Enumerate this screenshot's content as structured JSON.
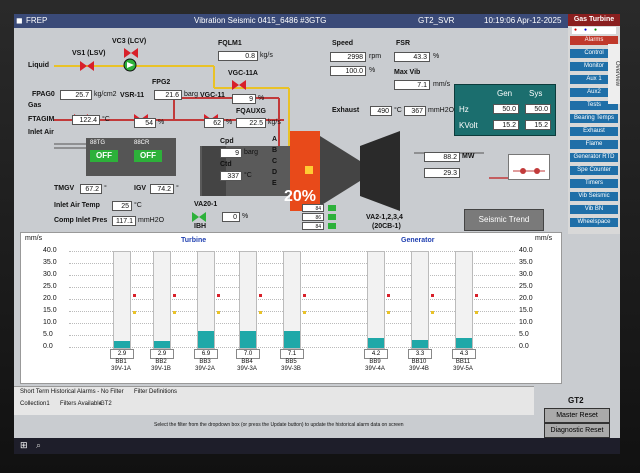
{
  "titlebar": {
    "app": "FREP",
    "title": "Vibration Seismic 0415_6486 #3GTG",
    "station": "GT2_SVR",
    "datetime": "10:19:06 Apr-12-2025"
  },
  "sidepanel": {
    "title": "Gas Turbine",
    "items": [
      "Alarms",
      "Control",
      "Monitor",
      "Aux 1",
      "Aux2",
      "Tests",
      "Bearing Temps",
      "Exhaust",
      "Flame",
      "Generator RTD",
      "Spe Counter",
      "Timers",
      "Vib Seismic",
      "Vib BN",
      "Wheelspace"
    ],
    "overview_tab": "Overview"
  },
  "process": {
    "liquid_label": "Liquid",
    "gas_label": "Gas",
    "inlet_air_label": "Inlet Air",
    "vs1": "VS1 (LSV)",
    "vc3": "VC3 (LCV)",
    "fqlm1_label": "FQLM1",
    "fqlm1_value": "0.8",
    "fqlm1_unit": "kg/s",
    "speed_label": "Speed",
    "speed_value": "2998",
    "speed_unit": "rpm",
    "speed_pct": "100.0",
    "fsr_label": "FSR",
    "fsr_value": "43.3",
    "fsr_unit": "%",
    "maxvib_label": "Max Vib",
    "maxvib_value": "7.1",
    "maxvib_unit": "mm/s",
    "fpg2_label": "FPG2",
    "fpg2_value": "21.6",
    "fpg2_unit": "barg",
    "vgc11a_label": "VGC-11A",
    "vgc11a_value": "9",
    "fpago_label": "FPAG0",
    "fpago_value": "25.7",
    "fpago_unit": "kg/cm2",
    "vsr11_label": "VSR-11",
    "vgc11_label": "VGC-11",
    "ftagim_label": "FTAGIM",
    "ftagim_value": "122.4",
    "ftagim_unit": "°C",
    "vsr_pct": "54",
    "vgc_pct": "62",
    "fqauxg_label": "FQAUXG",
    "fqauxg_value": "22.5",
    "fqauxg_unit": "kg/s",
    "exhaust_label": "Exhaust",
    "exhaust_temp": "490",
    "exhaust_temp_unit": "°C",
    "exhaust_press": "367",
    "exhaust_press_unit": "mmH2O",
    "gen_label": "Gen",
    "sys_label": "Sys",
    "hz_label": "Hz",
    "hz_gen": "50.0",
    "hz_sys": "50.0",
    "kvolt_label": "KVolt",
    "kv_gen": "15.2",
    "kv_sys": "15.2",
    "bt_88": "88TG",
    "bt_88_state": "OFF",
    "bt_qcr": "88CR",
    "bt_qcr_state": "OFF",
    "cpd_label": "Cpd",
    "cpd_value": "9",
    "cpd_unit": "barg",
    "ctd_label": "Ctd",
    "ctd_value": "337",
    "ctd_unit": "°C",
    "chambers": [
      "A",
      "B",
      "C",
      "D",
      "E"
    ],
    "mw_value": "88.2",
    "mw_unit": "MW",
    "mvar_value": "29.3",
    "tmgv_label": "TMGV",
    "tmgv_value": "67.2",
    "tmgv_unit": "°",
    "igv_label": "IGV",
    "igv_value": "74.2",
    "igv_unit": "°",
    "inlet_air_temp_label": "Inlet Air Temp",
    "inlet_air_temp_value": "25",
    "inlet_air_temp_unit": "°C",
    "comp_inlet_label": "Comp Inlet Pres",
    "comp_inlet_value": "117.1",
    "comp_inlet_unit": "mmH2O",
    "va20_label": "VA20-1",
    "va20_value": "0",
    "va20_unit": "%",
    "ibh_label": "IBH",
    "va2_label": "VA2-1,2,3,4",
    "va2_sub": "(20CB-1)",
    "overlay_pct": "20%",
    "seismic_trend_btn": "Seismic Trend",
    "bleed_nums": [
      "84",
      "86",
      "84"
    ]
  },
  "trend": {
    "unit_left": "mm/s",
    "unit_right": "mm/s",
    "turbine_label": "Turbine",
    "generator_label": "Generator",
    "axis_ticks": [
      "40.0",
      "35.0",
      "30.0",
      "25.0",
      "20.0",
      "15.0",
      "10.0",
      "5.0",
      "0.0"
    ],
    "ymax": 40,
    "bars": [
      {
        "name": "BB1",
        "tag": "39V-1A",
        "value": 2.9
      },
      {
        "name": "BB2",
        "tag": "39V-1B",
        "value": 2.9
      },
      {
        "name": "BB3",
        "tag": "39V-2A",
        "value": 6.9
      },
      {
        "name": "BB4",
        "tag": "39V-3A",
        "value": 7.0
      },
      {
        "name": "BB5",
        "tag": "39V-3B",
        "value": 7.1
      },
      {
        "name": "BB9",
        "tag": "39V-4A",
        "value": 4.2
      },
      {
        "name": "BB10",
        "tag": "39V-4B",
        "value": 3.3
      },
      {
        "name": "BB11",
        "tag": "39V-5A",
        "value": 4.3
      }
    ],
    "bar_values_text": [
      "2.9",
      "2.9",
      "6.9",
      "7.0",
      "7.1",
      "4.2",
      "3.3",
      "4.3"
    ]
  },
  "alarms": {
    "header": "Short Term Historical Alarms - No Filter",
    "filter_defs": "Filter Definitions",
    "collection": "Collection1",
    "filters": "Filters Available",
    "filter_value": "GT2",
    "hint": "Select the filter from the dropdown box (or press the Update button) to update the historical alarm data on screen"
  },
  "controls": {
    "unit": "GT2",
    "master_reset": "Master Reset",
    "diagnostic_reset": "Diagnostic Reset"
  },
  "colors": {
    "valve_red": "#d8202a",
    "valve_green": "#2db13a",
    "pipe_liquid": "#e9c227",
    "pipe_gas": "#c23a3a",
    "pipe_air": "#2a8ac4",
    "bar_fill": "#1fa8a8"
  }
}
